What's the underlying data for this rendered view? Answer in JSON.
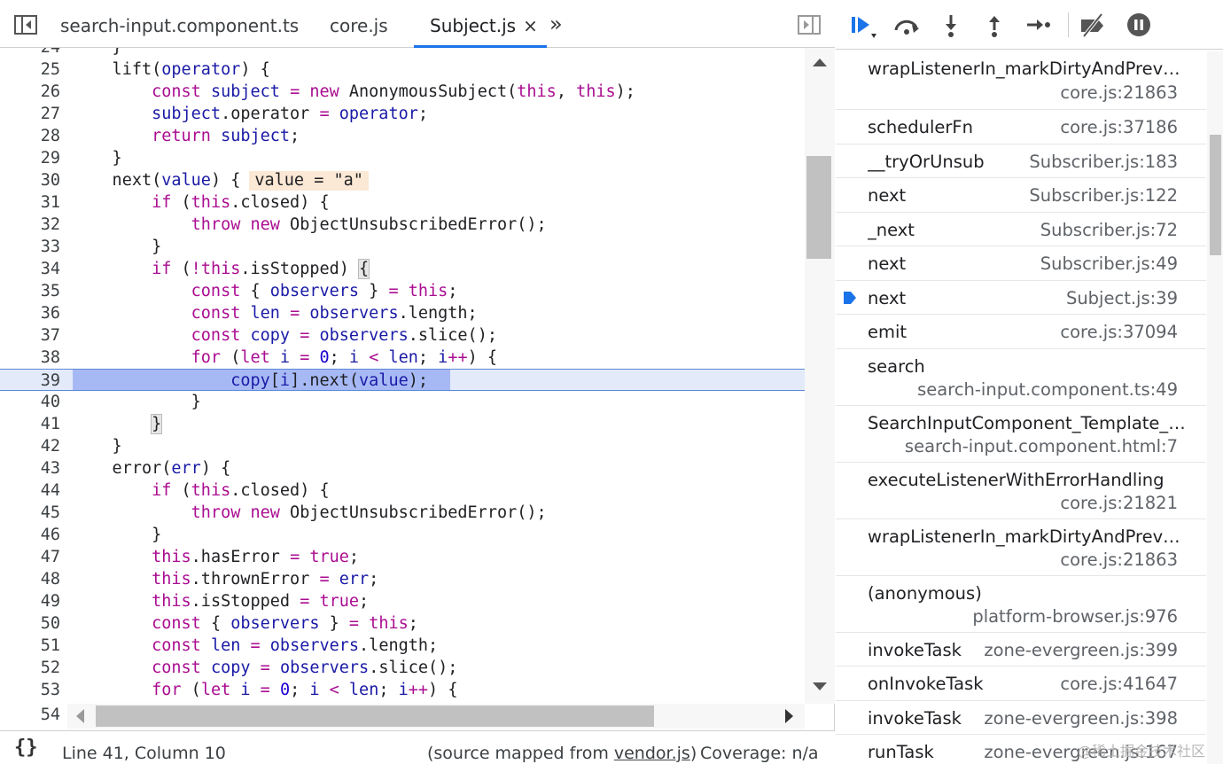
{
  "tabs": [
    {
      "label": "search-input.component.ts",
      "active": false
    },
    {
      "label": "core.js",
      "active": false
    },
    {
      "label": "Subject.js",
      "active": true,
      "close": "×"
    }
  ],
  "tab_overflow": "»",
  "code": {
    "partial_top_line": "24",
    "lines": [
      {
        "n": "25",
        "html": "    lift(<span class=\"id\">operator</span>) {"
      },
      {
        "n": "26",
        "html": "        <span class=\"kw\">const</span> <span class=\"id\">subject</span> <span class=\"op\">=</span> <span class=\"kw\">new</span> AnonymousSubject(<span class=\"kw\">this</span>, <span class=\"kw\">this</span>);"
      },
      {
        "n": "27",
        "html": "        <span class=\"id\">subject</span>.operator <span class=\"op\">=</span> <span class=\"id\">operator</span>;"
      },
      {
        "n": "28",
        "html": "        <span class=\"kw\">return</span> <span class=\"id\">subject</span>;"
      },
      {
        "n": "29",
        "html": "    }"
      },
      {
        "n": "30",
        "html": "    next(<span class=\"id\">value</span>) {<span class=\"inline-val\">value = \"a\"</span>"
      },
      {
        "n": "31",
        "html": "        <span class=\"kw\">if</span> (<span class=\"kw\">this</span>.closed) {"
      },
      {
        "n": "32",
        "html": "            <span class=\"kw\">throw</span> <span class=\"kw\">new</span> ObjectUnsubscribedError();"
      },
      {
        "n": "33",
        "html": "        }"
      },
      {
        "n": "34",
        "html": "        <span class=\"kw\">if</span> (<span class=\"op\">!</span><span class=\"kw\">this</span>.isStopped) <span class=\"brace-mark\">{</span>"
      },
      {
        "n": "35",
        "html": "            <span class=\"kw\">const</span> { <span class=\"id\">observers</span> } <span class=\"op\">=</span> <span class=\"kw\">this</span>;"
      },
      {
        "n": "36",
        "html": "            <span class=\"kw\">const</span> <span class=\"id\">len</span> <span class=\"op\">=</span> <span class=\"id\">observers</span>.length;"
      },
      {
        "n": "37",
        "html": "            <span class=\"kw\">const</span> <span class=\"id\">copy</span> <span class=\"op\">=</span> <span class=\"id\">observers</span>.slice();"
      },
      {
        "n": "38",
        "html": "            <span class=\"kw\">for</span> (<span class=\"kw\">let</span> <span class=\"id\">i</span> <span class=\"op\">=</span> <span class=\"num\">0</span>; <span class=\"id\">i</span> <span class=\"op\">&lt;</span> <span class=\"id\">len</span>; <span class=\"id\">i</span><span class=\"op\">++</span>) {"
      },
      {
        "n": "39",
        "html": "                <span class=\"id\">copy</span>[<span class=\"id\">i</span>].next(<span class=\"id\">value</span>);",
        "highlight": true
      },
      {
        "n": "40",
        "html": "            }"
      },
      {
        "n": "41",
        "html": "        <span class=\"brace-mark\">}</span>"
      },
      {
        "n": "42",
        "html": "    }"
      },
      {
        "n": "43",
        "html": "    error(<span class=\"id\">err</span>) {"
      },
      {
        "n": "44",
        "html": "        <span class=\"kw\">if</span> (<span class=\"kw\">this</span>.closed) {"
      },
      {
        "n": "45",
        "html": "            <span class=\"kw\">throw</span> <span class=\"kw\">new</span> ObjectUnsubscribedError();"
      },
      {
        "n": "46",
        "html": "        }"
      },
      {
        "n": "47",
        "html": "        <span class=\"kw\">this</span>.hasError <span class=\"op\">=</span> <span class=\"kw\">true</span>;"
      },
      {
        "n": "48",
        "html": "        <span class=\"kw\">this</span>.thrownError <span class=\"op\">=</span> <span class=\"id\">err</span>;"
      },
      {
        "n": "49",
        "html": "        <span class=\"kw\">this</span>.isStopped <span class=\"op\">=</span> <span class=\"kw\">true</span>;"
      },
      {
        "n": "50",
        "html": "        <span class=\"kw\">const</span> { <span class=\"id\">observers</span> } <span class=\"op\">=</span> <span class=\"kw\">this</span>;"
      },
      {
        "n": "51",
        "html": "        <span class=\"kw\">const</span> <span class=\"id\">len</span> <span class=\"op\">=</span> <span class=\"id\">observers</span>.length;"
      },
      {
        "n": "52",
        "html": "        <span class=\"kw\">const</span> <span class=\"id\">copy</span> <span class=\"op\">=</span> <span class=\"id\">observers</span>.slice();"
      },
      {
        "n": "53",
        "html": "        <span class=\"kw\">for</span> (<span class=\"kw\">let</span> <span class=\"id\">i</span> <span class=\"op\">=</span> <span class=\"num\">0</span>; <span class=\"id\">i</span> <span class=\"op\">&lt;</span> <span class=\"id\">len</span>; <span class=\"id\">i</span><span class=\"op\">++</span>) {"
      }
    ],
    "bottom_line": "54"
  },
  "status": {
    "position": "Line 41, Column 10",
    "mapped_prefix": "(source mapped from ",
    "mapped_link": "vendor.js",
    "mapped_suffix": ")",
    "coverage": "Coverage: n/a"
  },
  "callstack": [
    {
      "name": "wrapListenerIn_markDirtyAndPrevent…",
      "loc": "core.js:21863",
      "layout": "first"
    },
    {
      "name": "schedulerFn",
      "loc": "core.js:37186",
      "layout": "one"
    },
    {
      "name": "__tryOrUnsub",
      "loc": "Subscriber.js:183",
      "layout": "one"
    },
    {
      "name": "next",
      "loc": "Subscriber.js:122",
      "layout": "one"
    },
    {
      "name": "_next",
      "loc": "Subscriber.js:72",
      "layout": "one"
    },
    {
      "name": "next",
      "loc": "Subscriber.js:49",
      "layout": "one"
    },
    {
      "name": "next",
      "loc": "Subject.js:39",
      "layout": "one",
      "current": true
    },
    {
      "name": "emit",
      "loc": "core.js:37094",
      "layout": "one"
    },
    {
      "name": "search",
      "loc": "search-input.component.ts:49",
      "layout": "two"
    },
    {
      "name": "SearchInputComponent_Template_in…",
      "loc": "search-input.component.html:7",
      "layout": "two"
    },
    {
      "name": "executeListenerWithErrorHandling",
      "loc": "core.js:21821",
      "layout": "two"
    },
    {
      "name": "wrapListenerIn_markDirtyAndPrevent…",
      "loc": "core.js:21863",
      "layout": "two"
    },
    {
      "name": "(anonymous)",
      "loc": "platform-browser.js:976",
      "layout": "two"
    },
    {
      "name": "invokeTask",
      "loc": "zone-evergreen.js:399",
      "layout": "one"
    },
    {
      "name": "onInvokeTask",
      "loc": "core.js:41647",
      "layout": "one"
    },
    {
      "name": "invokeTask",
      "loc": "zone-evergreen.js:398",
      "layout": "one"
    },
    {
      "name": "runTask",
      "loc": "zone-evergreen.js:167",
      "layout": "one"
    }
  ],
  "watermark": "@稀土掘金技术社区",
  "colors": {
    "accent": "#1a73e8",
    "highlight_line": "#e3ebfa",
    "highlight_code": "#a7b9f5",
    "keyword": "#aa0d91",
    "identifier": "#1a1aa6"
  }
}
